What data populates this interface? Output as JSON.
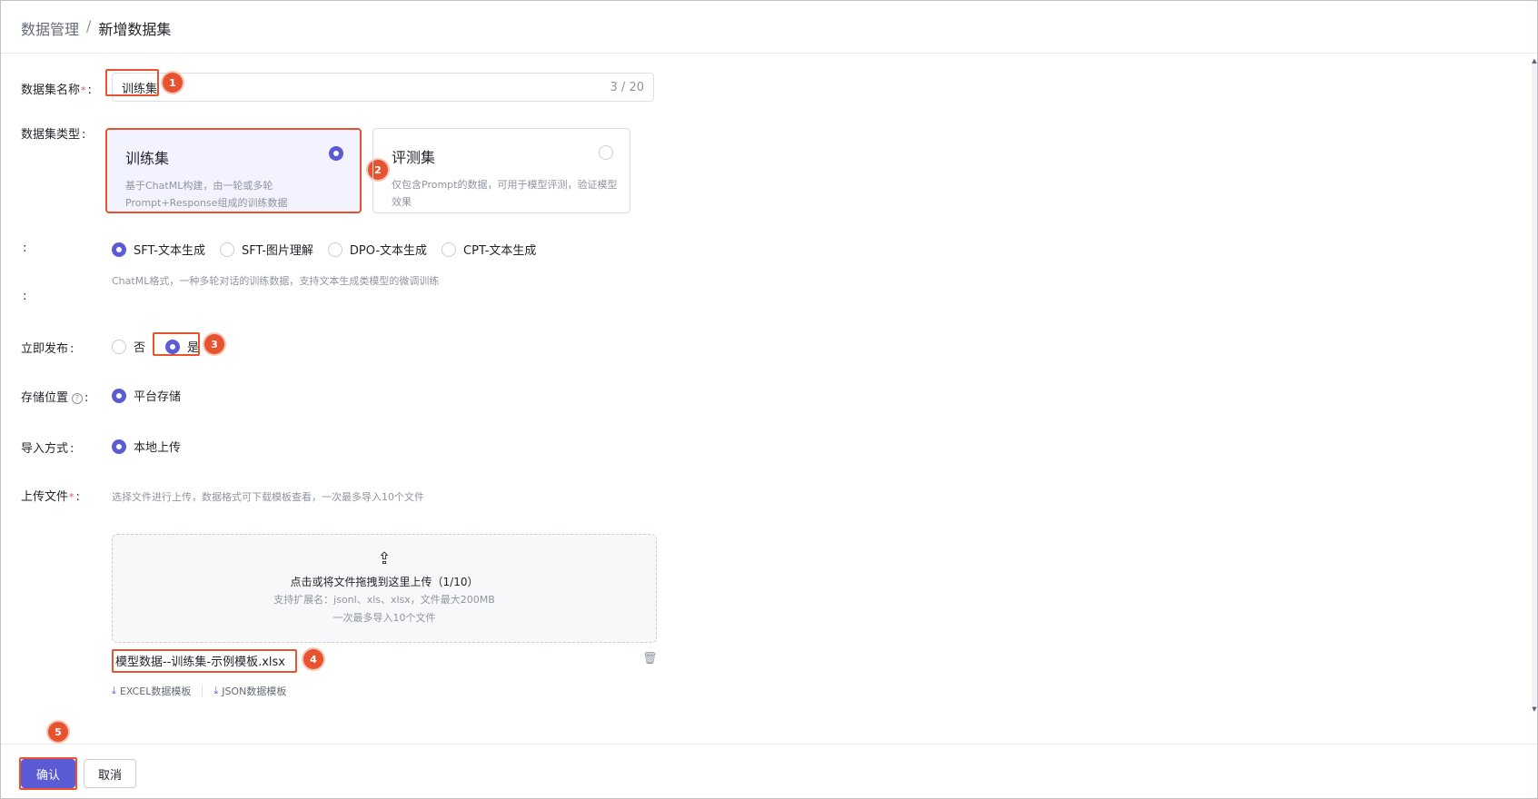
{
  "breadcrumb": {
    "parent": "数据管理",
    "separator": "/",
    "current": "新增数据集"
  },
  "form": {
    "name": {
      "label": "数据集名称",
      "required": "*",
      "value": "训练集",
      "count": "3 / 20"
    },
    "type": {
      "label": "数据集类型",
      "options": [
        {
          "title": "训练集",
          "desc": "基于ChatML构建，由一轮或多轮Prompt+Response组成的训练数据",
          "selected": true
        },
        {
          "title": "评测集",
          "desc": "仅包含Prompt的数据，可用于模型评测，验证模型效果",
          "selected": false
        }
      ]
    },
    "format": {
      "label": "",
      "options": [
        "SFT-文本生成",
        "SFT-图片理解",
        "DPO-文本生成",
        "CPT-文本生成"
      ],
      "selected": "SFT-文本生成",
      "hint": "ChatML格式，一种多轮对话的训练数据，支持文本生成类模型的微调训练"
    },
    "extra_label": "",
    "publish": {
      "label": "立即发布",
      "options": [
        "否",
        "是"
      ],
      "selected": "是"
    },
    "storage": {
      "label": "存储位置",
      "help_icon": "question-circle-icon",
      "option": "平台存储"
    },
    "import": {
      "label": "导入方式",
      "option": "本地上传"
    },
    "upload": {
      "label": "上传文件",
      "required": "*",
      "hint": "选择文件进行上传，数据格式可下载模板查看，一次最多导入10个文件",
      "drop_main": "点击或将文件拖拽到这里上传（1/10）",
      "drop_ext": "支持扩展名：jsonl、xls、xlsx，文件最大200MB",
      "drop_limit": "一次最多导入10个文件",
      "file_name": "模型数据--训练集-示例模板.xlsx",
      "templates": [
        "EXCEL数据模板",
        "JSON数据模板"
      ]
    }
  },
  "footer": {
    "confirm": "确认",
    "cancel": "取消"
  },
  "annotations": [
    "1",
    "2",
    "3",
    "4",
    "5"
  ],
  "colors": {
    "primary": "#5b5bd6",
    "highlight": "#e8532f",
    "required": "#e34d59"
  }
}
